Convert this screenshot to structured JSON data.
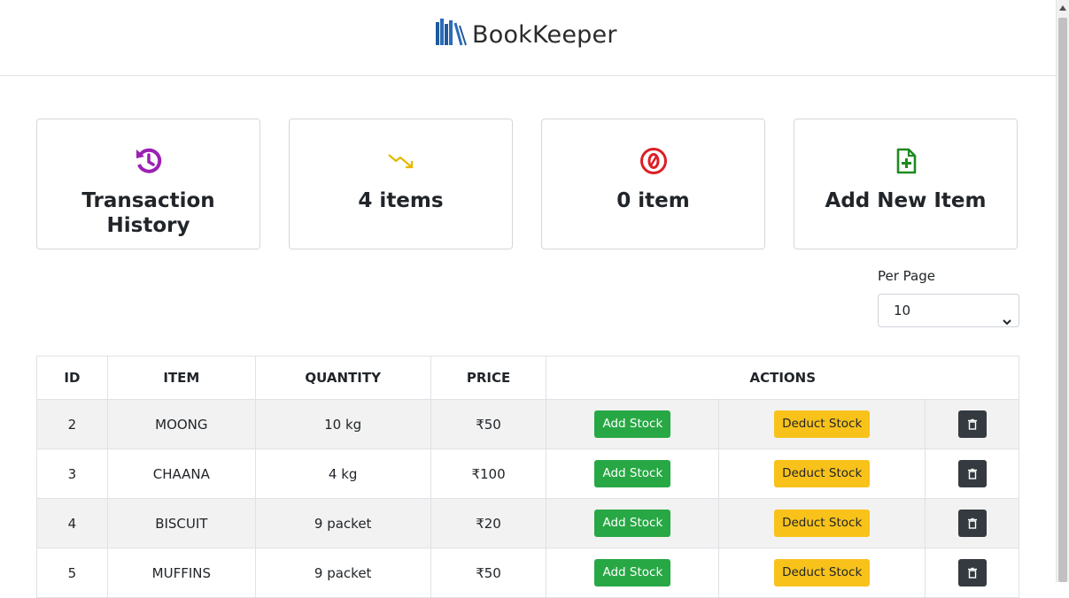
{
  "header": {
    "brand": "BookKeeper"
  },
  "cards": [
    {
      "label": "Transaction History",
      "icon": "history-icon",
      "color": "#9c1fb3"
    },
    {
      "label": "4 items",
      "icon": "trending-down-icon",
      "color": "#e6b800"
    },
    {
      "label": "0 item",
      "icon": "zero-circle-icon",
      "color": "#dc1f26"
    },
    {
      "label": "Add New Item",
      "icon": "file-plus-icon",
      "color": "#1f8a1f"
    }
  ],
  "per_page": {
    "label": "Per Page",
    "value": "10"
  },
  "table": {
    "headers": {
      "id": "ID",
      "item": "ITEM",
      "quantity": "QUANTITY",
      "price": "PRICE",
      "actions": "ACTIONS"
    },
    "rows": [
      {
        "id": "2",
        "item": "MOONG",
        "quantity": "10 kg",
        "price": "₹50"
      },
      {
        "id": "3",
        "item": "CHAANA",
        "quantity": "4 kg",
        "price": "₹100"
      },
      {
        "id": "4",
        "item": "BISCUIT",
        "quantity": "9 packet",
        "price": "₹20"
      },
      {
        "id": "5",
        "item": "MUFFINS",
        "quantity": "9 packet",
        "price": "₹50"
      }
    ],
    "add_label": "Add Stock",
    "deduct_label": "Deduct Stock"
  }
}
